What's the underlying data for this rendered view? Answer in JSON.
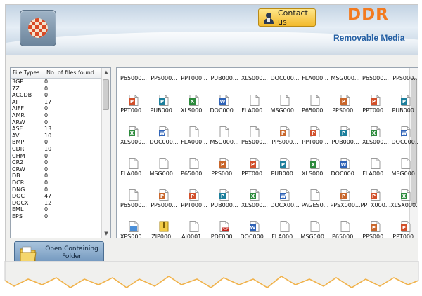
{
  "header": {
    "contact_label": "Contact us",
    "brand": "DDR",
    "subtitle": "Removable Media"
  },
  "file_types": {
    "col1": "File Types",
    "col2": "No. of files found",
    "rows": [
      {
        "type": "3GP",
        "count": "0"
      },
      {
        "type": "7Z",
        "count": "0"
      },
      {
        "type": "ACCDB",
        "count": "0"
      },
      {
        "type": "AI",
        "count": "17"
      },
      {
        "type": "AIFF",
        "count": "0"
      },
      {
        "type": "AMR",
        "count": "0"
      },
      {
        "type": "ARW",
        "count": "0"
      },
      {
        "type": "ASF",
        "count": "13"
      },
      {
        "type": "AVI",
        "count": "10"
      },
      {
        "type": "BMP",
        "count": "0"
      },
      {
        "type": "CDR",
        "count": "10"
      },
      {
        "type": "CHM",
        "count": "0"
      },
      {
        "type": "CR2",
        "count": "0"
      },
      {
        "type": "CRW",
        "count": "0"
      },
      {
        "type": "DB",
        "count": "0"
      },
      {
        "type": "DCR",
        "count": "0"
      },
      {
        "type": "DNG",
        "count": "0"
      },
      {
        "type": "DOC",
        "count": "47"
      },
      {
        "type": "DOCX",
        "count": "12"
      },
      {
        "type": "EML",
        "count": "0"
      },
      {
        "type": "EPS",
        "count": "0"
      }
    ]
  },
  "files": {
    "top_row": [
      "P65000...",
      "PPS000...",
      "PPT000...",
      "PUB000...",
      "XLS000...",
      "DOC000...",
      "FLA000...",
      "MSG000...",
      "P65000...",
      "PPS000..."
    ],
    "rows": [
      [
        {
          "name": "PPT000...",
          "icon": "ppt-icon"
        },
        {
          "name": "PUB000...",
          "icon": "pub-icon"
        },
        {
          "name": "XLS000...",
          "icon": "xls-icon"
        },
        {
          "name": "DOC000...",
          "icon": "doc-icon"
        },
        {
          "name": "FLA000...",
          "icon": "blank-file-icon"
        },
        {
          "name": "MSG000...",
          "icon": "blank-file-icon"
        },
        {
          "name": "P65000...",
          "icon": "blank-file-icon"
        },
        {
          "name": "PPS000...",
          "icon": "pps-icon"
        },
        {
          "name": "PPT000...",
          "icon": "ppt-icon"
        },
        {
          "name": "PUB000...",
          "icon": "pub-icon"
        }
      ],
      [
        {
          "name": "XLS000...",
          "icon": "xls-icon"
        },
        {
          "name": "DOC000...",
          "icon": "doc-icon"
        },
        {
          "name": "FLA000...",
          "icon": "blank-file-icon"
        },
        {
          "name": "MSG000...",
          "icon": "blank-file-icon"
        },
        {
          "name": "P65000...",
          "icon": "blank-file-icon"
        },
        {
          "name": "PPS000...",
          "icon": "pps-icon"
        },
        {
          "name": "PPT000...",
          "icon": "ppt-icon"
        },
        {
          "name": "PUB000...",
          "icon": "pub-icon"
        },
        {
          "name": "XLS000...",
          "icon": "xls-icon"
        },
        {
          "name": "DOC000...",
          "icon": "doc-icon"
        }
      ],
      [
        {
          "name": "FLA000...",
          "icon": "blank-file-icon"
        },
        {
          "name": "MSG000...",
          "icon": "blank-file-icon"
        },
        {
          "name": "P65000...",
          "icon": "blank-file-icon"
        },
        {
          "name": "PPS000...",
          "icon": "pps-icon"
        },
        {
          "name": "PPT000...",
          "icon": "ppt-icon"
        },
        {
          "name": "PUB000...",
          "icon": "pub-icon"
        },
        {
          "name": "XLS000...",
          "icon": "xls-icon"
        },
        {
          "name": "DOC000...",
          "icon": "doc-icon"
        },
        {
          "name": "FLA000...",
          "icon": "blank-file-icon"
        },
        {
          "name": "MSG000...",
          "icon": "blank-file-icon"
        }
      ],
      [
        {
          "name": "P65000...",
          "icon": "blank-file-icon"
        },
        {
          "name": "PPS000...",
          "icon": "pps-icon"
        },
        {
          "name": "PPT000...",
          "icon": "ppt-icon"
        },
        {
          "name": "PUB000...",
          "icon": "pub-icon"
        },
        {
          "name": "XLS000...",
          "icon": "xls-icon"
        },
        {
          "name": "DOCX00...",
          "icon": "doc-icon"
        },
        {
          "name": "PAGES0...",
          "icon": "blank-file-icon"
        },
        {
          "name": "PPSX000...",
          "icon": "pps-icon"
        },
        {
          "name": "PPTX000...",
          "icon": "ppt-icon"
        },
        {
          "name": "XLSX000...",
          "icon": "xls-icon"
        }
      ],
      [
        {
          "name": "XPS000...",
          "icon": "xps-icon"
        },
        {
          "name": "ZIP000...",
          "icon": "zip-icon"
        },
        {
          "name": "AI0001...",
          "icon": "blank-file-icon"
        },
        {
          "name": "PDF000...",
          "icon": "pdf-icon"
        },
        {
          "name": "DOC000...",
          "icon": "doc-icon"
        },
        {
          "name": "FLA000...",
          "icon": "blank-file-icon"
        },
        {
          "name": "MSG000...",
          "icon": "blank-file-icon"
        },
        {
          "name": "P65000...",
          "icon": "blank-file-icon"
        },
        {
          "name": "PPS000...",
          "icon": "pps-icon"
        },
        {
          "name": "PPT000...",
          "icon": "ppt-icon"
        }
      ]
    ]
  },
  "open_button_label": "Open Containing Folder",
  "colors": {
    "brand": "#f37a1f",
    "subtitle": "#2560a4",
    "contact_bg": "#f2b92c",
    "open_btn_bg": "#6d93bb"
  }
}
